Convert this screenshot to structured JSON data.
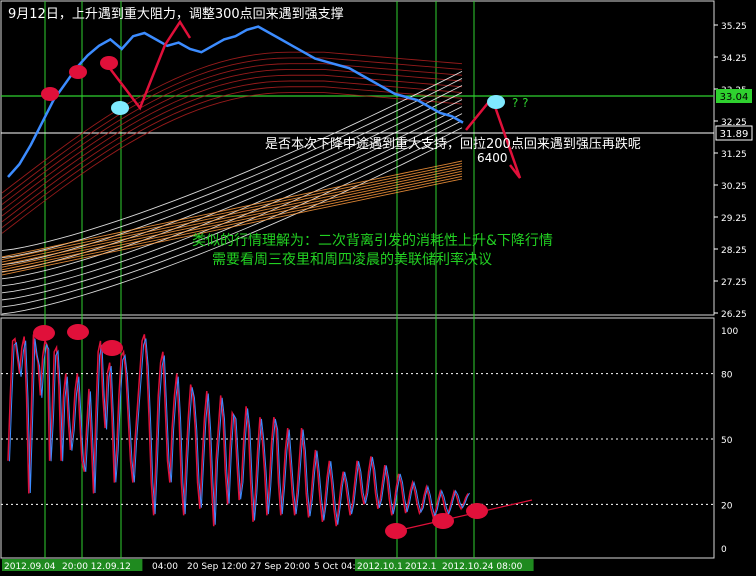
{
  "annotations": {
    "top_text": "9月12日，上升遇到重大阻力，调整300点回来遇到强支撑",
    "mid_text": "是否本次下降中途遇到重大支持，回拉200点回来遇到强压再跌呢",
    "level_text": "6400",
    "question_marks": "? ?",
    "comment_line1": "类似的行情理解为：二次背离引发的消耗性上升&下降行情",
    "comment_line2": "需要看周三夜里和周四凌晨的美联储利率决议"
  },
  "price_panel": {
    "y_ticks": [
      "35.25",
      "34.25",
      "33.25",
      "32.25",
      "31.25",
      "30.25",
      "29.25",
      "28.25",
      "27.25",
      "26.25"
    ],
    "current_price": "33.04",
    "marker_price": "31.89"
  },
  "oscillator_panel": {
    "y_ticks": [
      "100",
      "80",
      "50",
      "20",
      "0"
    ],
    "levels": [
      80,
      50,
      20
    ]
  },
  "time_axis": {
    "labels": [
      "2012.09.04",
      "20:00 12.09.12",
      "04:00",
      "20 Sep 12:00",
      "27 Sep 20:00",
      "5 Oct 04:00",
      "2012.10.1",
      "2012.1",
      "2012.10.24 08:00"
    ]
  },
  "colors": {
    "background": "#000000",
    "green_line": "#2fd12f",
    "price": "#3c8cff",
    "red_marker": "#e0103a",
    "cyan_marker": "#7fe9ff",
    "red_annotation": "#e0103a",
    "comment": "#22d022"
  },
  "chart_data": {
    "type": "line",
    "price_series": {
      "x": [
        0,
        1,
        2,
        3,
        4,
        5,
        6,
        7,
        8,
        9,
        10,
        11,
        12,
        13,
        14,
        15,
        16,
        17,
        18,
        19,
        20,
        21,
        22,
        23,
        24,
        25,
        26,
        27,
        28,
        29,
        30,
        31,
        32,
        33,
        34,
        35,
        36,
        37,
        38,
        39,
        40
      ],
      "values": [
        30.5,
        30.9,
        31.5,
        32.2,
        32.9,
        33.4,
        33.9,
        34.3,
        34.6,
        34.8,
        34.5,
        34.9,
        35.0,
        34.8,
        34.6,
        34.7,
        34.5,
        34.4,
        34.6,
        34.8,
        34.9,
        35.1,
        35.2,
        35.0,
        34.8,
        34.6,
        34.4,
        34.2,
        34.1,
        34.0,
        33.9,
        33.7,
        33.5,
        33.3,
        33.1,
        33.0,
        32.9,
        32.7,
        32.5,
        32.4,
        32.2
      ]
    },
    "oscillator_series": {
      "x": [
        0,
        1,
        2,
        3,
        4,
        5,
        6,
        7,
        8,
        9,
        10,
        11,
        12,
        13,
        14,
        15,
        16,
        17,
        18,
        19,
        20,
        21,
        22,
        23,
        24,
        25,
        26,
        27,
        28,
        29,
        30,
        31,
        32,
        33,
        34,
        35,
        36,
        37,
        38,
        39,
        40,
        41,
        42,
        43,
        44,
        45,
        46,
        47,
        48,
        49,
        50,
        51,
        52,
        53,
        54,
        55,
        56,
        57,
        58,
        59,
        60,
        61,
        62,
        63,
        64,
        65,
        66,
        67,
        68,
        69,
        70,
        71,
        72,
        73,
        74,
        75,
        76,
        77,
        78,
        79,
        80,
        81,
        82,
        83,
        84,
        85,
        86,
        87,
        88,
        89,
        90,
        91,
        92,
        93,
        94,
        95,
        96,
        97,
        98,
        99,
        100,
        101,
        102,
        103,
        104,
        105,
        106,
        107,
        108,
        109,
        110,
        111,
        112,
        113,
        114,
        115,
        116,
        117,
        118,
        119,
        120,
        121,
        122,
        123,
        124,
        125,
        126,
        127,
        128,
        129,
        130,
        131,
        132,
        133,
        134,
        135,
        136,
        137,
        138,
        139,
        140,
        141,
        142,
        143,
        144,
        145,
        146,
        147,
        148,
        149,
        150,
        151,
        152,
        153,
        154,
        155,
        156,
        157,
        158,
        159,
        160,
        161,
        162,
        163,
        164,
        165,
        166,
        167,
        168,
        169,
        170,
        171,
        172,
        173,
        174,
        175,
        176,
        177,
        178,
        179,
        180,
        181,
        182,
        183,
        184,
        185,
        186,
        187,
        188,
        189,
        190,
        191,
        192,
        193,
        194,
        195,
        196,
        197,
        198,
        199
      ],
      "values": [
        40,
        70,
        95,
        96,
        88,
        80,
        92,
        97,
        70,
        25,
        60,
        98,
        90,
        85,
        70,
        88,
        95,
        93,
        40,
        60,
        90,
        92,
        75,
        40,
        70,
        80,
        60,
        45,
        55,
        72,
        80,
        60,
        40,
        35,
        55,
        73,
        50,
        25,
        60,
        90,
        95,
        70,
        55,
        80,
        85,
        60,
        30,
        45,
        70,
        88,
        90,
        80,
        60,
        40,
        30,
        50,
        65,
        80,
        95,
        98,
        85,
        60,
        30,
        15,
        40,
        70,
        85,
        90,
        65,
        40,
        30,
        55,
        70,
        80,
        60,
        30,
        15,
        40,
        60,
        75,
        70,
        55,
        30,
        18,
        40,
        60,
        72,
        55,
        30,
        10,
        40,
        55,
        70,
        60,
        35,
        20,
        45,
        62,
        60,
        40,
        22,
        30,
        50,
        65,
        55,
        30,
        12,
        25,
        45,
        60,
        50,
        35,
        15,
        28,
        48,
        60,
        55,
        30,
        15,
        28,
        45,
        55,
        40,
        25,
        15,
        25,
        40,
        55,
        45,
        25,
        14,
        22,
        35,
        45,
        35,
        22,
        12,
        20,
        32,
        40,
        30,
        18,
        10,
        18,
        28,
        35,
        30,
        22,
        15,
        20,
        30,
        40,
        35,
        25,
        20,
        25,
        35,
        42,
        36,
        25,
        18,
        22,
        30,
        38,
        32,
        22,
        15,
        20,
        28,
        34,
        30,
        22,
        16,
        20,
        26,
        30,
        26,
        20,
        16,
        18,
        24,
        28,
        24,
        18,
        14,
        17,
        22,
        26,
        23,
        18,
        15,
        18,
        22,
        26,
        24,
        20,
        18,
        20,
        23,
        25
      ]
    },
    "oscillator_ylim": [
      0,
      100
    ],
    "price_ylim": [
      26.25,
      35.25
    ]
  }
}
